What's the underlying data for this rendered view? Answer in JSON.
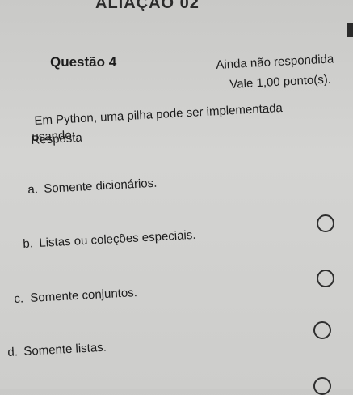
{
  "header": {
    "title": "ALIAÇÃO 02"
  },
  "question": {
    "title": "Questão 4",
    "status": "Ainda não respondida",
    "value": "Vale 1,00 ponto(s).",
    "text_line1": "Em Python, uma pilha pode ser implementada",
    "text_line2": "usando:",
    "answer_label": "Resposta"
  },
  "options": [
    {
      "letter": "a.",
      "text": "Somente dicionários."
    },
    {
      "letter": "b.",
      "text": "Listas ou coleções especiais."
    },
    {
      "letter": "c.",
      "text": "Somente conjuntos."
    },
    {
      "letter": "d.",
      "text": "Somente listas."
    }
  ]
}
